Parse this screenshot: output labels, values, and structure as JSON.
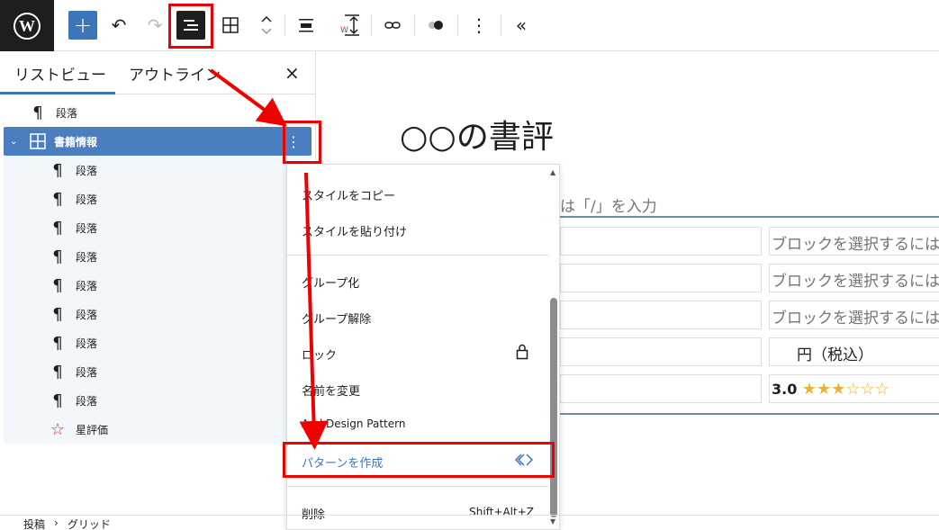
{
  "toolbar": {
    "add_label": "+",
    "undo_glyph": "↶",
    "redo_glyph": "↷",
    "more_glyph": "⋮",
    "collapse_glyph": "«"
  },
  "sidebar": {
    "tab_list": "リストビュー",
    "tab_outline": "アウトライン",
    "close_glyph": "×",
    "tree": [
      {
        "label": "段落",
        "level": 0,
        "icon": "paragraph-icon"
      },
      {
        "label": "書籍情報",
        "level": 0,
        "icon": "table-icon",
        "selected": true
      },
      {
        "label": "段落",
        "level": 1,
        "icon": "paragraph-icon"
      },
      {
        "label": "段落",
        "level": 1,
        "icon": "paragraph-icon"
      },
      {
        "label": "段落",
        "level": 1,
        "icon": "paragraph-icon"
      },
      {
        "label": "段落",
        "level": 1,
        "icon": "paragraph-icon"
      },
      {
        "label": "段落",
        "level": 1,
        "icon": "paragraph-icon"
      },
      {
        "label": "段落",
        "level": 1,
        "icon": "paragraph-icon"
      },
      {
        "label": "段落",
        "level": 1,
        "icon": "paragraph-icon"
      },
      {
        "label": "段落",
        "level": 1,
        "icon": "paragraph-icon"
      },
      {
        "label": "段落",
        "level": 1,
        "icon": "paragraph-icon"
      },
      {
        "label": "星評価",
        "level": 1,
        "icon": "star-outline-icon"
      }
    ]
  },
  "breadcrumb": {
    "items": [
      "投稿",
      "グリッド"
    ],
    "separator": "›"
  },
  "canvas": {
    "title": "○○の書評",
    "placeholder": "は「/」を入力",
    "rows": [
      {
        "right": "ブロックを選択するには"
      },
      {
        "right": "ブロックを選択するには"
      },
      {
        "right": "ブロックを選択するには"
      },
      {
        "right": "円（税込）"
      },
      {
        "right": "3.0"
      }
    ],
    "rating_value": "3.0",
    "rating_stars_filled": 3,
    "rating_stars_total": 6
  },
  "menu": {
    "items": [
      {
        "label": "スタイルをコピー"
      },
      {
        "label": "スタイルを貼り付け"
      },
      {
        "label": "グループ化"
      },
      {
        "label": "グループ解除"
      },
      {
        "label": "ロック"
      },
      {
        "label": "名前を変更"
      },
      {
        "label": "Add Design Pattern"
      },
      {
        "label": "パターンを作成"
      },
      {
        "label": "削除",
        "shortcut": "Shift+Alt+Z"
      }
    ]
  },
  "colors": {
    "accent": "#3d76b8",
    "highlight_red": "#ee0000",
    "star": "#e8b23a"
  }
}
